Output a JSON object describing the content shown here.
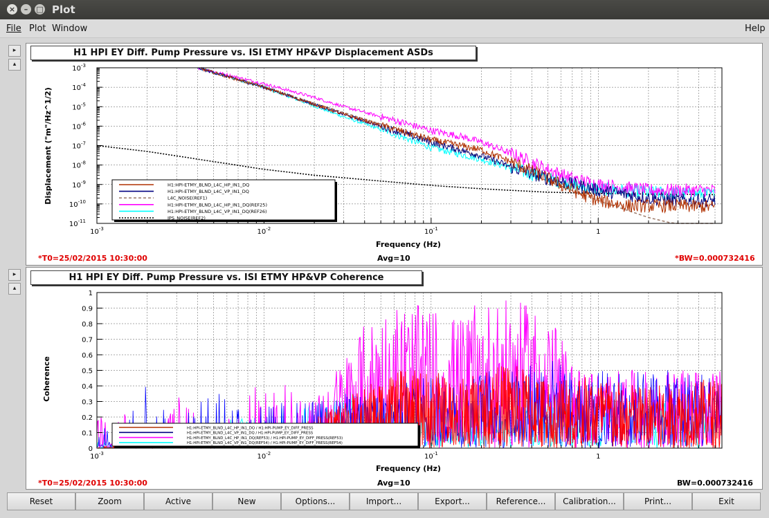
{
  "window": {
    "title": "Plot"
  },
  "menu": {
    "file": "File",
    "plot": "Plot",
    "window": "Window",
    "help": "Help"
  },
  "plot1": {
    "title": "H1 HPI EY Diff. Pump Pressure vs. ISI ETMY HP&VP Displacement ASDs",
    "t0": "*T0=25/02/2015 10:30:00",
    "avg": "Avg=10",
    "bw": "*BW=0.000732416",
    "ylabel": "Displacement (\"m\"/Hz^1/2)",
    "xlabel": "Frequency (Hz)"
  },
  "plot2": {
    "title": "H1 HPI EY Diff. Pump Pressure vs. ISI ETMY HP&VP Coherence",
    "t0": "*T0=25/02/2015 10:30:00",
    "avg": "Avg=10",
    "bw": "BW=0.000732416",
    "ylabel": "Coherence",
    "xlabel": "Frequency (Hz)"
  },
  "buttons": [
    "Reset",
    "Zoom",
    "Active",
    "New",
    "Options...",
    "Import...",
    "Export...",
    "Reference...",
    "Calibration...",
    "Print...",
    "Exit"
  ],
  "colors": {
    "red": "#ff0000",
    "darkred": "#b03000",
    "blue": "#0000ff",
    "darkblue": "#000080",
    "magenta": "#ff00ff",
    "cyan": "#00ffff",
    "gray": "#a08070",
    "black": "#000000"
  },
  "chart_data": [
    {
      "type": "line",
      "title": "H1 HPI EY Diff. Pump Pressure vs. ISI ETMY HP&VP Displacement ASDs",
      "xlabel": "Frequency (Hz)",
      "ylabel": "Displacement (\"m\"/Hz^1/2)",
      "xscale": "log",
      "yscale": "log",
      "xlim": [
        0.001,
        5.5
      ],
      "ylim": [
        1e-11,
        0.001
      ],
      "xticks": [
        "10^-3",
        "10^-2",
        "10^-1",
        "1"
      ],
      "yticks": [
        "10^-3",
        "10^-4",
        "10^-5",
        "10^-6",
        "10^-7",
        "10^-8",
        "10^-9",
        "10^-10",
        "10^-11"
      ],
      "grid": true,
      "legend_position": "bottom-left",
      "series": [
        {
          "name": "H1:HPI-ETMY_BLND_L4C_HP_IN1_DQ",
          "color": "#b03000",
          "style": "solid",
          "x": [
            0.004,
            0.01,
            0.03,
            0.06,
            0.1,
            0.2,
            0.3,
            0.5,
            0.8,
            1,
            1.5,
            2,
            3,
            5
          ],
          "y": [
            0.001,
            0.0001,
            4e-06,
            7e-07,
            2e-07,
            6e-08,
            1.5e-08,
            2e-09,
            3e-10,
            1.5e-10,
            8e-11,
            8e-11,
            8e-11,
            7e-11
          ]
        },
        {
          "name": "H1:HPI-ETMY_BLND_L4C_VP_IN1_DQ",
          "color": "#000080",
          "style": "solid",
          "x": [
            0.004,
            0.01,
            0.03,
            0.06,
            0.1,
            0.2,
            0.3,
            0.5,
            0.8,
            1,
            1.5,
            2,
            3,
            5
          ],
          "y": [
            0.001,
            0.0001,
            4e-06,
            6e-07,
            1.5e-07,
            3e-08,
            8e-09,
            2e-09,
            8e-10,
            5e-10,
            3e-10,
            2e-10,
            1.5e-10,
            1.5e-10
          ]
        },
        {
          "name": "L4C_NOISE(REF1)",
          "color": "#a08070",
          "style": "dashed",
          "x": [
            0.004,
            0.01,
            0.03,
            0.1,
            0.3,
            0.5,
            1,
            2,
            5
          ],
          "y": [
            0.001,
            0.0001,
            5e-06,
            2e-07,
            8e-09,
            1.5e-09,
            1.5e-10,
            2e-11,
            3e-12
          ]
        },
        {
          "name": "H1:HPI-ETMY_BLND_L4C_HP_IN1_DQ(REF25)",
          "color": "#ff00ff",
          "style": "solid",
          "x": [
            0.004,
            0.01,
            0.02,
            0.03,
            0.06,
            0.1,
            0.15,
            0.2,
            0.3,
            0.5,
            0.7,
            1,
            2,
            5
          ],
          "y": [
            0.001,
            0.00015,
            3e-05,
            1e-05,
            2e-06,
            6e-07,
            3e-07,
            1.5e-07,
            4e-08,
            6e-09,
            2e-09,
            1e-09,
            5e-10,
            5e-10
          ]
        },
        {
          "name": "H1:HPI-ETMY_BLND_L4C_VP_IN1_DQ(REF26)",
          "color": "#00ffff",
          "style": "solid",
          "x": [
            0.004,
            0.01,
            0.03,
            0.06,
            0.1,
            0.2,
            0.3,
            0.5,
            0.8,
            1,
            2,
            5
          ],
          "y": [
            0.001,
            0.0001,
            3e-06,
            4e-07,
            8e-08,
            2e-08,
            7e-09,
            2e-09,
            8e-10,
            6e-10,
            4e-10,
            3e-10
          ]
        },
        {
          "name": "IPS_NOISE(REF2)",
          "color": "#000000",
          "style": "dotted",
          "x": [
            0.001,
            0.002,
            0.005,
            0.01,
            0.02,
            0.05,
            0.1,
            0.2,
            0.5,
            1,
            2,
            5
          ],
          "y": [
            1e-07,
            5e-08,
            1.5e-08,
            6e-09,
            3e-09,
            1.5e-09,
            9e-10,
            6e-10,
            4e-10,
            3.5e-10,
            3.2e-10,
            3e-10
          ]
        }
      ]
    },
    {
      "type": "line",
      "title": "H1 HPI EY Diff. Pump Pressure vs. ISI ETMY HP&VP Coherence",
      "xlabel": "Frequency (Hz)",
      "ylabel": "Coherence",
      "xscale": "log",
      "xlim": [
        0.001,
        5.5
      ],
      "ylim": [
        0,
        1
      ],
      "xticks": [
        "10^-3",
        "10^-2",
        "10^-1",
        "1"
      ],
      "yticks": [
        "0",
        "0.1",
        "0.2",
        "0.3",
        "0.4",
        "0.5",
        "0.6",
        "0.7",
        "0.8",
        "0.9",
        "1"
      ],
      "grid": true,
      "legend_position": "bottom-left",
      "series": [
        {
          "name": "H1:HPI-ETMY_BLND_L4C_HP_IN1_DQ / H1:HPI-PUMP_EY_DIFF_PRESS",
          "color": "#b03000"
        },
        {
          "name": "H1:HPI-ETMY_BLND_L4C_VP_IN1_DQ / H1:HPI-PUMP_EY_DIFF_PRESS",
          "color": "#000080"
        },
        {
          "name": "H1:HPI-ETMY_BLND_L4C_HP_IN1_DQ(REF53) / H1:HPI-PUMP_EY_DIFF_PRESS(REF53)",
          "color": "#ff00ff"
        },
        {
          "name": "H1:HPI-ETMY_BLND_L4C_VP_IN1_DQ(REF54) / H1:HPI-PUMP_EY_DIFF_PRESS(REF54)",
          "color": "#00ffff"
        }
      ],
      "envelope": {
        "x": [
          0.001,
          0.0015,
          0.002,
          0.003,
          0.005,
          0.008,
          0.01,
          0.02,
          0.04,
          0.06,
          0.1,
          0.15,
          0.2,
          0.3,
          0.5,
          0.7,
          1,
          2,
          5
        ],
        "magenta": [
          0.2,
          0.25,
          0.1,
          0.35,
          0.1,
          0.35,
          0.55,
          0.3,
          0.8,
          0.95,
          0.9,
          0.85,
          0.95,
          0.95,
          0.9,
          0.55,
          0.5,
          0.5,
          0.5
        ],
        "red": [
          0.0,
          0.05,
          0.05,
          0.05,
          0.05,
          0.1,
          0.1,
          0.2,
          0.4,
          0.5,
          0.5,
          0.45,
          0.5,
          0.55,
          0.45,
          0.5,
          0.45,
          0.4,
          0.45
        ],
        "blue": [
          0.2,
          0.15,
          0.45,
          0.2,
          0.4,
          0.2,
          0.3,
          0.3,
          0.35,
          0.4,
          0.5,
          0.45,
          0.5,
          0.5,
          0.6,
          0.5,
          0.5,
          0.5,
          0.5
        ],
        "cyan": [
          0.05,
          0.1,
          0.1,
          0.15,
          0.2,
          0.2,
          0.25,
          0.3,
          0.4,
          0.3,
          0.3,
          0.25,
          0.25,
          0.2,
          0.3,
          0.3,
          0.3,
          0.3,
          0.3
        ]
      }
    }
  ]
}
